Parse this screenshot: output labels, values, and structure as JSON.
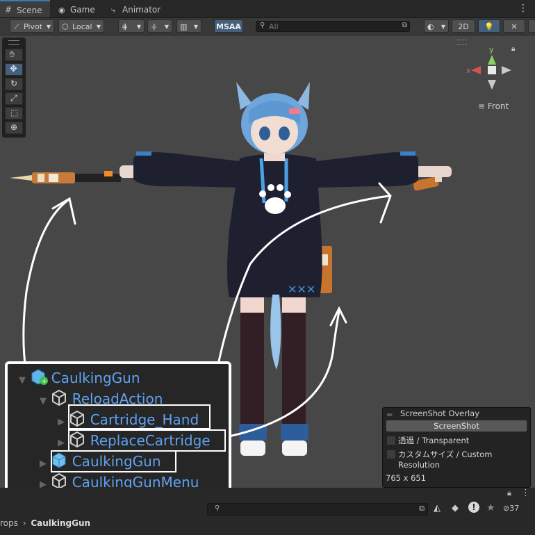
{
  "tabs": {
    "scene": "Scene",
    "game": "Game",
    "animator": "Animator"
  },
  "toolbar": {
    "pivot": "Pivot",
    "local": "Local",
    "msaa": "MSAA",
    "search_placeholder": "All",
    "mode2d": "2D"
  },
  "gizmo": {
    "y": "y",
    "x": "x",
    "view": "Front"
  },
  "overlay": {
    "title": "ScreenShot Overlay",
    "button": "ScreenShot",
    "opt_transparent": "透過 / Transparent",
    "opt_custom": "カスタムサイズ / Custom Resolution",
    "resolution": "765 x 651"
  },
  "hierarchy": {
    "root": "CaulkingGun",
    "reload": "ReloadAction",
    "cartridge_hand": "Cartridge_Hand",
    "replace_cartridge": "ReplaceCartridge",
    "gun": "CaulkingGun",
    "menu": "CaulkingGunMenu"
  },
  "bottom": {
    "breadcrumb_prefix": "rops",
    "breadcrumb_item": "CaulkingGun",
    "count": "37"
  },
  "colors": {
    "accent": "#3a79bb",
    "hier_text": "#5fa2f2",
    "outline": "#ffffff"
  }
}
